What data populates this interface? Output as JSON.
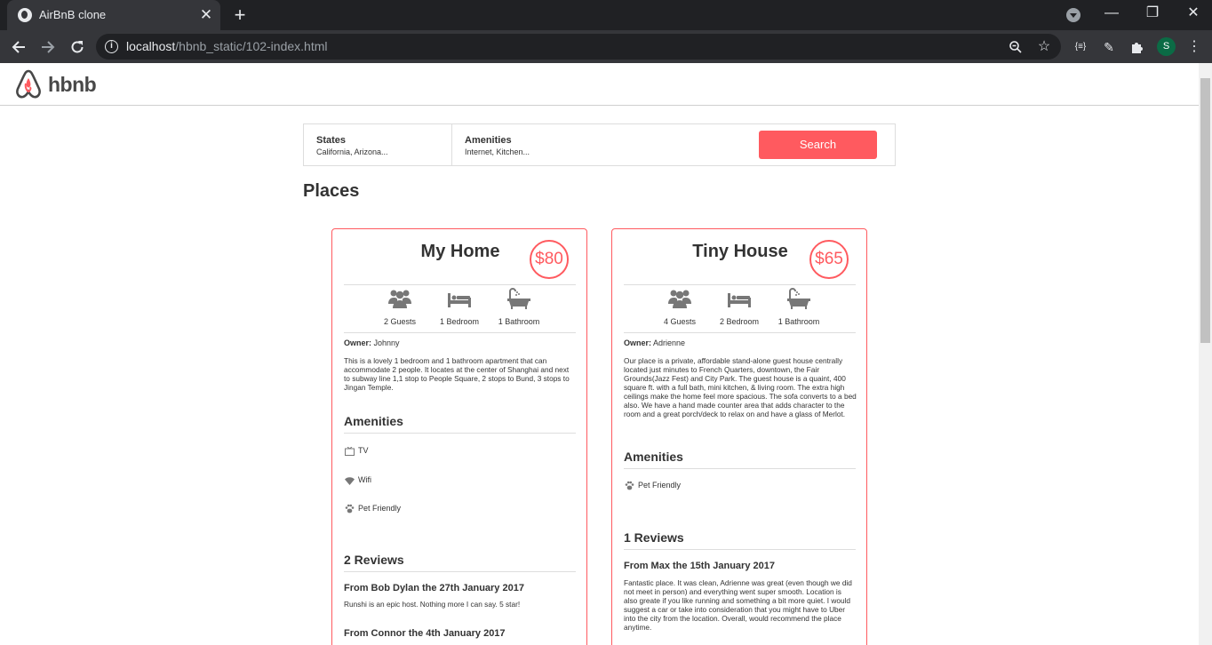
{
  "browser": {
    "tab_title": "AirBnB clone",
    "tab_close": "✕",
    "new_tab": "+",
    "url_host": "localhost",
    "url_path": "/hbnb_static/102-index.html",
    "profile_initial": "S",
    "min": "—",
    "restore": "❐",
    "close": "✕"
  },
  "site": {
    "logo_text": "hbnb"
  },
  "filters": {
    "states_title": "States",
    "states_value": "California, Arizona...",
    "amenities_title": "Amenities",
    "amenities_value": "Internet, Kitchen...",
    "search_label": "Search"
  },
  "places_title": "Places",
  "places": [
    {
      "name": "My Home",
      "price": "$80",
      "guests": "2 Guests",
      "rooms": "1 Bedroom",
      "baths": "1 Bathroom",
      "owner_label": "Owner:",
      "owner": "Johnny",
      "description": "This is a lovely 1 bedroom and 1 bathroom apartment that can accommodate 2 people. It locates at the center of Shanghai and next to subway line 1,1 stop to People Square, 2 stops to Bund, 3 stops to Jingan Temple.",
      "amenities_title": "Amenities",
      "amenities": [
        {
          "icon": "tv-icon",
          "label": "TV"
        },
        {
          "icon": "wifi-icon",
          "label": "Wifi"
        },
        {
          "icon": "paw-icon",
          "label": "Pet Friendly"
        }
      ],
      "reviews_title": "2 Reviews",
      "reviews": [
        {
          "header": "From Bob Dylan the 27th January 2017",
          "text": "Runshi is an epic host. Nothing more I can say. 5 star!"
        },
        {
          "header": "From Connor the 4th January 2017",
          "text": ""
        }
      ]
    },
    {
      "name": "Tiny House",
      "price": "$65",
      "guests": "4 Guests",
      "rooms": "2 Bedroom",
      "baths": "1 Bathroom",
      "owner_label": "Owner:",
      "owner": "Adrienne",
      "description": "Our place is a private, affordable stand-alone guest house centrally located just minutes to French Quarters, downtown, the Fair Grounds(Jazz Fest) and City Park. The guest house is a quaint, 400 square ft. with a full bath, mini kitchen, & living room. The extra high ceilings make the home feel more spacious. The sofa converts to a bed also. We have a hand made counter area that adds character to the room and a great porch/deck to relax on and have a glass of Merlot.",
      "amenities_title": "Amenities",
      "amenities": [
        {
          "icon": "paw-icon",
          "label": "Pet Friendly"
        }
      ],
      "reviews_title": "1 Reviews",
      "reviews": [
        {
          "header": "From Max the 15th January 2017",
          "text": "Fantastic place. It was clean, Adrienne was great (even though we did not meet in person) and everything went super smooth. Location is also greate if you like running and something a bit more quiet. I would suggest a car or take into consideration that you might have to Uber into the city from the location. Overall, would recommend the place anytime."
        }
      ]
    }
  ],
  "colors": {
    "accent": "#ff5a5f",
    "chrome_dark": "#202124",
    "chrome_mid": "#35363a"
  }
}
